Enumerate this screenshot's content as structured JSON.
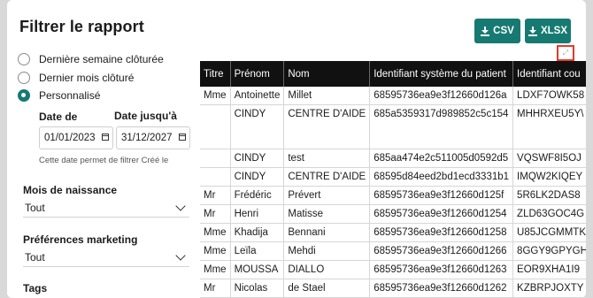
{
  "page": {
    "title": "Filtrer le rapport"
  },
  "export": {
    "csv_label": "CSV",
    "xlsx_label": "XLSX"
  },
  "period": {
    "options": [
      {
        "label": "Dernière semaine clôturée",
        "selected": false
      },
      {
        "label": "Dernier mois clôturé",
        "selected": false
      },
      {
        "label": "Personnalisé",
        "selected": true
      }
    ],
    "date_from_label": "Date de",
    "date_from_value": "01/01/2023",
    "date_to_label": "Date jusqu'à",
    "date_to_value": "31/12/2027",
    "helper": "Cette date permet de filtrer Créé le"
  },
  "filters": {
    "birth_month": {
      "label": "Mois de naissance",
      "value": "Tout"
    },
    "marketing": {
      "label": "Préférences marketing",
      "value": "Tout"
    },
    "tags": {
      "label": "Tags"
    }
  },
  "table": {
    "headers": [
      "Titre",
      "Prénom",
      "Nom",
      "Identifiant système du patient",
      "Identifiant cou"
    ],
    "rows": [
      [
        "Mme",
        "Antoinette",
        "Millet",
        "68595736ea9e3f12660d126a",
        "LDXF7OWK58"
      ],
      [
        "",
        "CINDY",
        "CENTRE D'AIDE",
        "685a5359317d989852c5c154",
        "MHHRXEU5Y\\"
      ],
      [
        "",
        "CINDY",
        "test",
        "685aa474e2c511005d0592d5",
        "VQSWF8I5OJ"
      ],
      [
        "",
        "CINDY",
        "CENTRE D'AIDE",
        "68595d84eed2bd1ecd3331b1",
        "IMQW2KIQEY"
      ],
      [
        "Mr",
        "Frédéric",
        "Prévert",
        "68595736ea9e3f12660d125f",
        "5R6LK2DAS8"
      ],
      [
        "Mr",
        "Henri",
        "Matisse",
        "68595736ea9e3f12660d1254",
        "ZLD63GOC4G"
      ],
      [
        "Mme",
        "Khadija",
        "Bennani",
        "68595736ea9e3f12660d1258",
        "U85JCGMMTK"
      ],
      [
        "Mme",
        "Leïla",
        "Mehdi",
        "68595736ea9e3f12660d1266",
        "8GGY9GPYGH"
      ],
      [
        "Mme",
        "MOUSSA",
        "DIALLO",
        "68595736ea9e3f12660d1263",
        "EOR9XHA1I9"
      ],
      [
        "Mr",
        "Nicolas",
        "de Stael",
        "68595736ea9e3f12660d1262",
        "KZBRPJOXTY"
      ]
    ]
  }
}
